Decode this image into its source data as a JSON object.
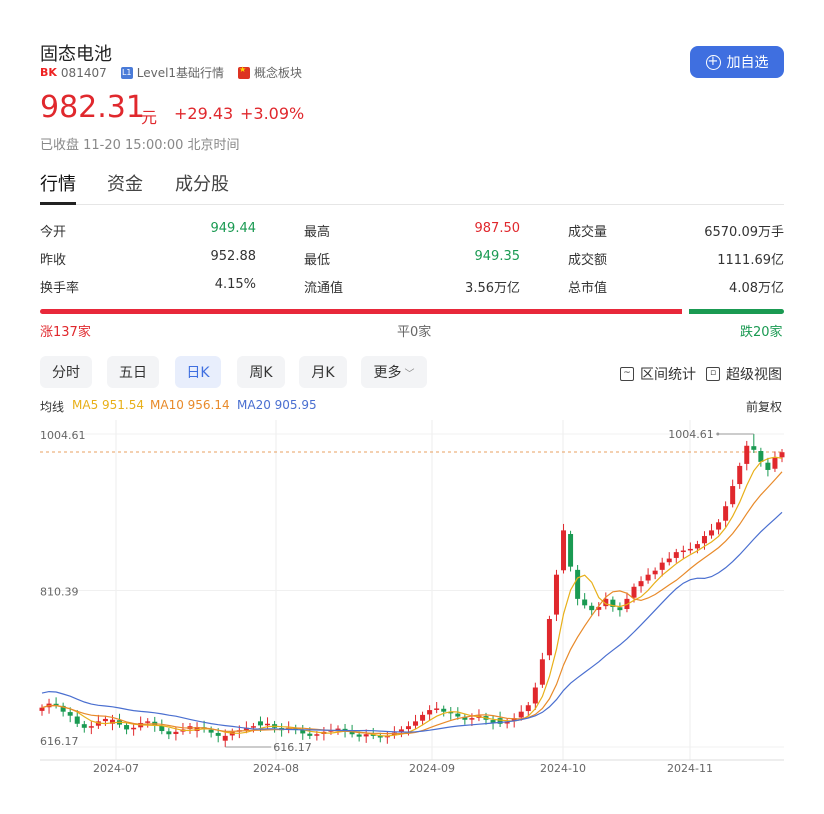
{
  "header": {
    "title": "固态电池",
    "code_badge": "BK",
    "code": "081407",
    "level_badge": "L1",
    "level_label": "Level1基础行情",
    "concept_label": "概念板块",
    "add_button": "加自选"
  },
  "quote": {
    "price": "982.31",
    "unit": "元",
    "change": "+29.43",
    "change_pct": "+3.09%",
    "status": "已收盘 11-20 15:00:00 北京时间"
  },
  "tabs": [
    "行情",
    "资金",
    "成分股"
  ],
  "stats": [
    {
      "label": "今开",
      "value": "949.44",
      "color": "green"
    },
    {
      "label": "最高",
      "value": "987.50",
      "color": "red"
    },
    {
      "label": "成交量",
      "value": "6570.09万手",
      "color": "dark"
    },
    {
      "label": "昨收",
      "value": "952.88",
      "color": "dark"
    },
    {
      "label": "最低",
      "value": "949.35",
      "color": "green"
    },
    {
      "label": "成交额",
      "value": "1111.69亿",
      "color": "dark"
    },
    {
      "label": "换手率",
      "value": "4.15%",
      "color": "dark"
    },
    {
      "label": "流通值",
      "value": "3.56万亿",
      "color": "dark"
    },
    {
      "label": "总市值",
      "value": "4.08万亿",
      "color": "dark"
    }
  ],
  "breadth": {
    "up": "涨137家",
    "flat": "平0家",
    "down": "跌20家",
    "up_count": 137,
    "flat_count": 0,
    "down_count": 20
  },
  "periods": [
    "分时",
    "五日",
    "日K",
    "周K",
    "月K",
    "更多"
  ],
  "tools": {
    "range_stats": "区间统计",
    "super_view": "超级视图"
  },
  "ma": {
    "label": "均线",
    "ma5": "MA5 951.54",
    "ma10": "MA10 956.14",
    "ma20": "MA20 905.95",
    "adjust": "前复权"
  },
  "colors": {
    "up": "#e0282d",
    "down": "#1a9a52",
    "accent": "#3f6fe0",
    "ma5": "#e8b01a",
    "ma10": "#e88a2a",
    "ma20": "#4a6fd0"
  },
  "chart_data": {
    "type": "candlestick",
    "y_labels": [
      "1004.61",
      "810.39",
      "616.17"
    ],
    "ylim": [
      616.17,
      1004.61
    ],
    "x_ticks": [
      "2024-07",
      "2024-08",
      "2024-09",
      "2024-10",
      "2024-11"
    ],
    "annotations": {
      "high": "1004.61",
      "low": "616.17"
    },
    "reference_line": 982.31,
    "closes": [
      665,
      670,
      668,
      660,
      655,
      645,
      640,
      642,
      648,
      651,
      650,
      644,
      638,
      640,
      646,
      648,
      643,
      636,
      632,
      635,
      638,
      642,
      641,
      638,
      634,
      630,
      630,
      635,
      637,
      640,
      642,
      643,
      645,
      640,
      637,
      640,
      638,
      633,
      630,
      632,
      635,
      637,
      639,
      636,
      632,
      629,
      632,
      630,
      628,
      630,
      634,
      638,
      642,
      648,
      656,
      662,
      664,
      660,
      658,
      654,
      650,
      652,
      655,
      650,
      646,
      645,
      648,
      652,
      660,
      668,
      690,
      725,
      775,
      830,
      885,
      840,
      800,
      792,
      786,
      790,
      800,
      790,
      786,
      800,
      815,
      822,
      830,
      835,
      845,
      850,
      858,
      860,
      862,
      868,
      878,
      885,
      895,
      915,
      940,
      965,
      990,
      985,
      970,
      960,
      975,
      982
    ],
    "ma5": 951.54,
    "ma10": 956.14,
    "ma20": 905.95
  }
}
